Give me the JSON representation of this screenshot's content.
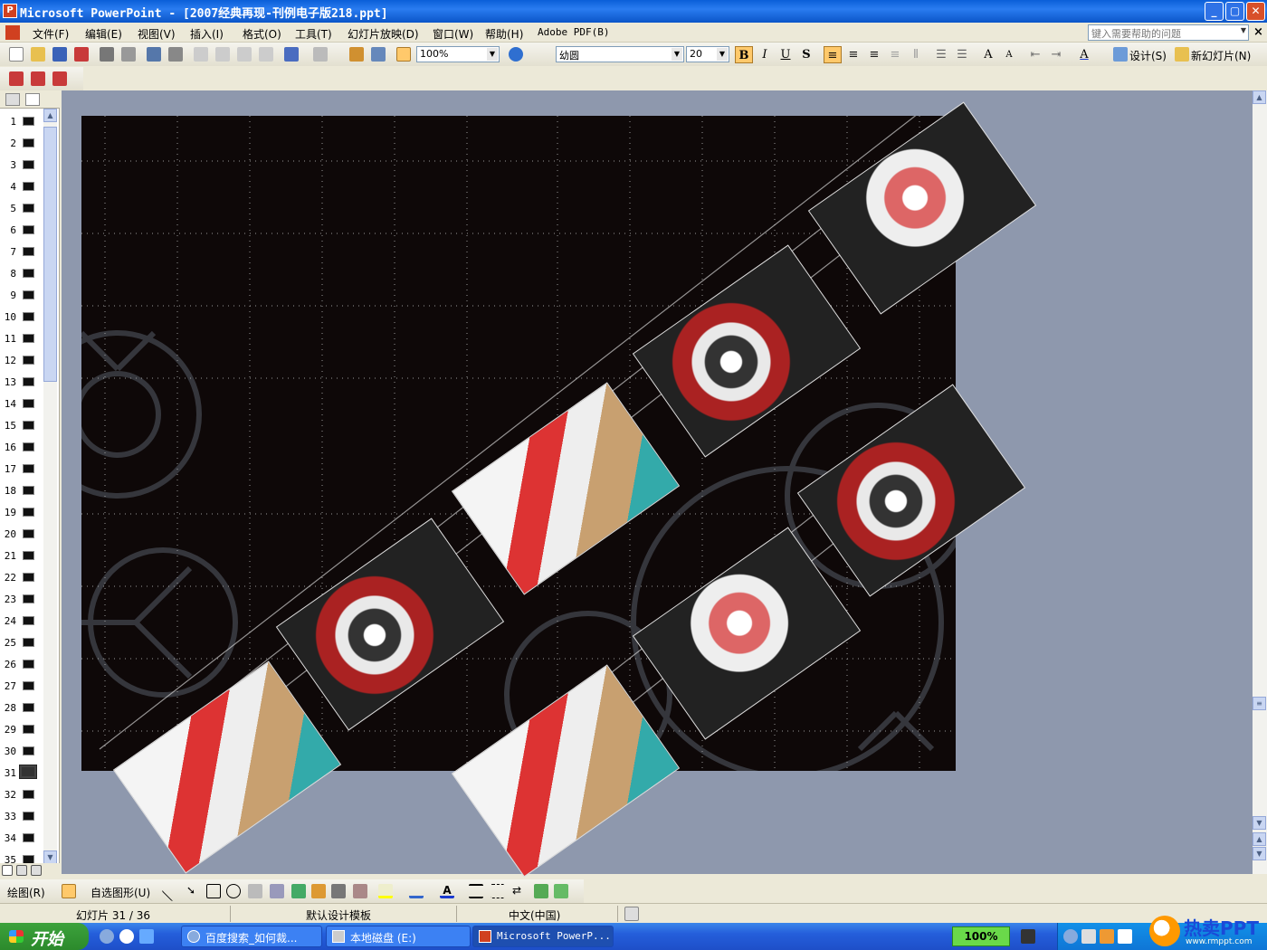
{
  "titlebar": {
    "title": "Microsoft PowerPoint - [2007经典再现-刊例电子版218.ppt]",
    "min": "_",
    "restore": "▢",
    "close": "✕"
  },
  "menu": {
    "items": [
      "文件(F)",
      "编辑(E)",
      "视图(V)",
      "插入(I)",
      "格式(O)",
      "工具(T)",
      "幻灯片放映(D)",
      "窗口(W)",
      "帮助(H)",
      "Adobe PDF(B)"
    ],
    "help_placeholder": "键入需要帮助的问题",
    "close": "×"
  },
  "toolbar": {
    "zoom": "100%",
    "font_name": "幼圆",
    "font_size": "20",
    "bold": "B",
    "italic": "I",
    "underline": "U",
    "shadow": "S",
    "design_label": "设计(S)",
    "new_slide_label": "新幻灯片(N)"
  },
  "slides": {
    "numbers": [
      "1",
      "2",
      "3",
      "4",
      "5",
      "6",
      "7",
      "8",
      "9",
      "10",
      "11",
      "12",
      "13",
      "14",
      "15",
      "16",
      "17",
      "18",
      "19",
      "20",
      "21",
      "22",
      "23",
      "24",
      "25",
      "26",
      "27",
      "28",
      "29",
      "30",
      "31",
      "32",
      "33",
      "34",
      "35"
    ],
    "selected": "31"
  },
  "drawbar": {
    "draw_label": "绘图(R)",
    "autoshapes_label": "自选图形(U)"
  },
  "status": {
    "slide_info": "幻灯片 31 / 36",
    "template": "默认设计模板",
    "language": "中文(中国)"
  },
  "taskbar": {
    "start": "开始",
    "tasks": [
      "百度搜索_如何裁...",
      "本地磁盘 (E:)",
      "Microsoft PowerP..."
    ],
    "zoom_badge": "100%",
    "brand": "热卖PPT",
    "brand_sub": "www.rmppt.com"
  },
  "colors": {
    "slide_bg": "#0e0808",
    "workspace": "#8e98ad",
    "title_blue": "#0a5fd8",
    "taskbar_blue": "#245edb"
  }
}
